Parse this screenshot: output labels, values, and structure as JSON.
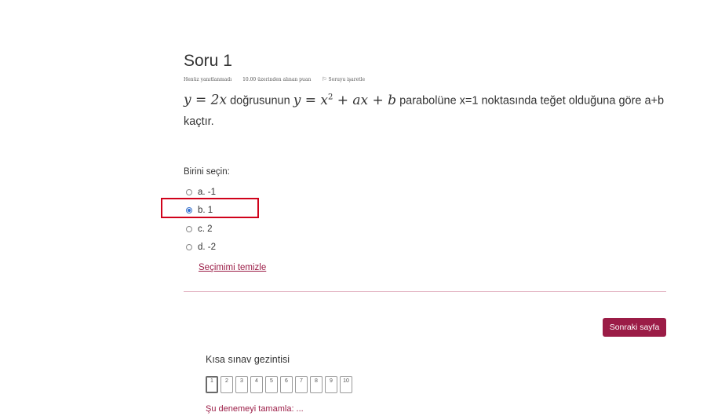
{
  "question": {
    "title": "Soru 1",
    "status": "Henüz yanıtlanmadı",
    "points": "10.00 üzerinden alınan puan",
    "flag_label": "Soruyu işaretle",
    "text": {
      "line_math": "y = 2x",
      "part1": "doğrusunun",
      "parabola_math_base": "y = x",
      "parabola_math_exp": "2",
      "parabola_math_rest": "+ ax + b",
      "part2": "parabolüne x=1 noktasında teğet olduğuna göre a+b kaçtır."
    },
    "prompt": "Birini seçin:",
    "options": [
      {
        "label": "a. -1",
        "selected": false
      },
      {
        "label": "b. 1",
        "selected": true
      },
      {
        "label": "c. 2",
        "selected": false
      },
      {
        "label": "d. -2",
        "selected": false
      }
    ],
    "clear_label": "Seçimimi temizle"
  },
  "next_button_label": "Sonraki sayfa",
  "quiz_nav": {
    "title": "Kısa sınav gezintisi",
    "pages": [
      "1",
      "2",
      "3",
      "4",
      "5",
      "6",
      "7",
      "8",
      "9",
      "10"
    ],
    "current_page": "1",
    "finish_label": "Şu denemeyi tamamla: ..."
  },
  "colors": {
    "accent": "#9b1c46",
    "highlight": "#d0021b",
    "radio_selected": "#2f6fd6"
  }
}
